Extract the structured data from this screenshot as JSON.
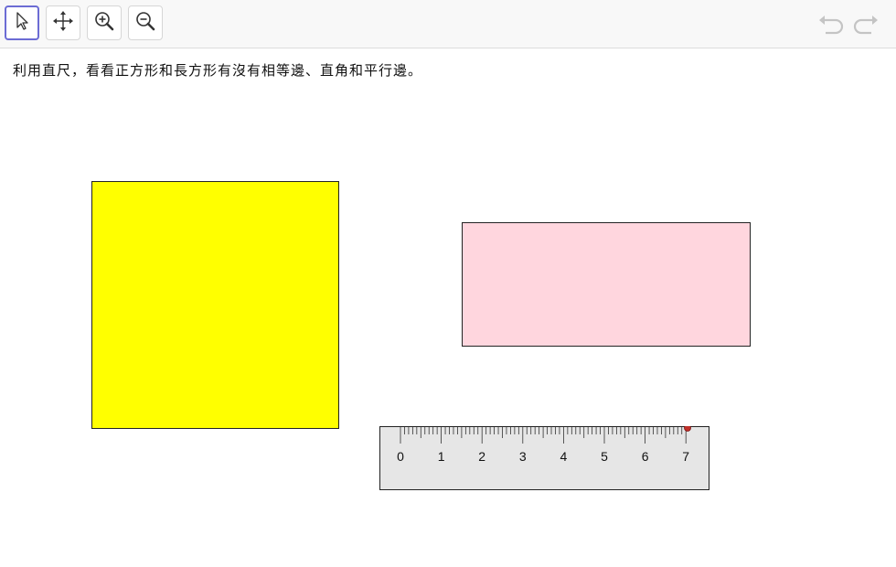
{
  "toolbar": {
    "tools": [
      {
        "name": "move-tool",
        "icon": "arrow-pointer-icon",
        "active": true
      },
      {
        "name": "move-graphics-view-tool",
        "icon": "four-arrows-icon",
        "active": false
      },
      {
        "name": "zoom-in-tool",
        "icon": "zoom-in-icon",
        "active": false
      },
      {
        "name": "zoom-out-tool",
        "icon": "zoom-out-icon",
        "active": false
      }
    ],
    "undo_icon": "undo-icon",
    "redo_icon": "redo-icon"
  },
  "instruction": "利用直尺，看看正方形和長方形有沒有相等邊、直角和平行邊。",
  "shapes": {
    "square": {
      "fill": "#ffff00",
      "stroke": "#222222"
    },
    "rectangle": {
      "fill": "#ffd6de",
      "stroke": "#222222"
    }
  },
  "ruler": {
    "labels": [
      "0",
      "1",
      "2",
      "3",
      "4",
      "5",
      "6",
      "7"
    ],
    "fill": "#e6e6e6",
    "handle_color": "#c0302a"
  }
}
